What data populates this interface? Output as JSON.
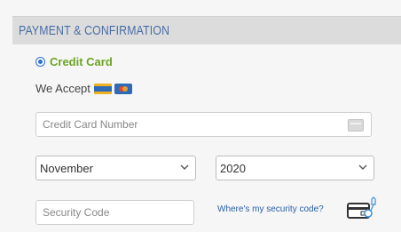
{
  "header": {
    "title": "PAYMENT & CONFIRMATION"
  },
  "payment": {
    "method_label": "Credit Card",
    "method_selected": true,
    "we_accept_label": "We Accept",
    "card_icons": [
      "visa-card-icon",
      "mastercard-icon"
    ]
  },
  "form": {
    "card_number_placeholder": "Credit Card Number",
    "month_value": "November",
    "year_value": "2020",
    "security_code_placeholder": "Security Code",
    "security_help_link": "Where's my security code?"
  },
  "colors": {
    "header_bg": "#dcdcdc",
    "header_text": "#4a6ea5",
    "method_label": "#6aa521",
    "link": "#2a5ea8"
  }
}
